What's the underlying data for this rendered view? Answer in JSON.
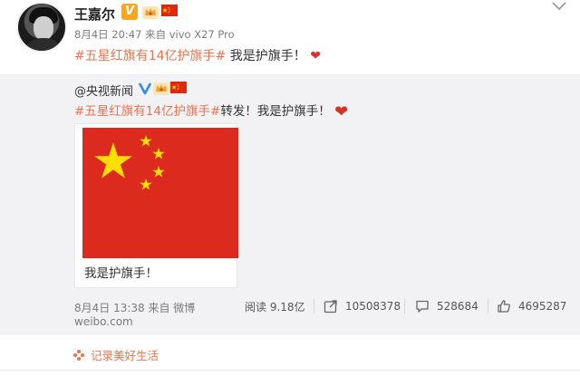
{
  "post": {
    "author": "王嘉尔",
    "verified_badge": "V",
    "meta": "8月4日 20:47 来自 vivo X27 Pro",
    "hashtag": "#五星红旗有14亿护旗手#",
    "text": " 我是护旗手！",
    "heart": "❤"
  },
  "repost": {
    "author": "@央视新闻",
    "hashtag": "#五星红旗有14亿护旗手#",
    "text": "转发！我是护旗手！",
    "heart": "❤",
    "card_caption": "我是护旗手！",
    "time": "8月4日 13:38 来自 微博",
    "domain": "weibo.com",
    "stats": {
      "reads": "阅读 9.18亿",
      "reposts": "10508378",
      "comments": "528684",
      "likes": "4695287"
    }
  },
  "life_tag": "记录美好生活",
  "icons": {
    "more": "chevron-down-icon",
    "repost": "share-icon",
    "comment": "comment-icon",
    "like": "thumbs-up-icon",
    "life": "flower-icon"
  },
  "colors": {
    "hashtag": "#eb7350",
    "flag_red": "#de2910",
    "star_yellow": "#ffde00",
    "badge_orange": "#f5a623",
    "badge_blue": "#2d8ee8"
  }
}
